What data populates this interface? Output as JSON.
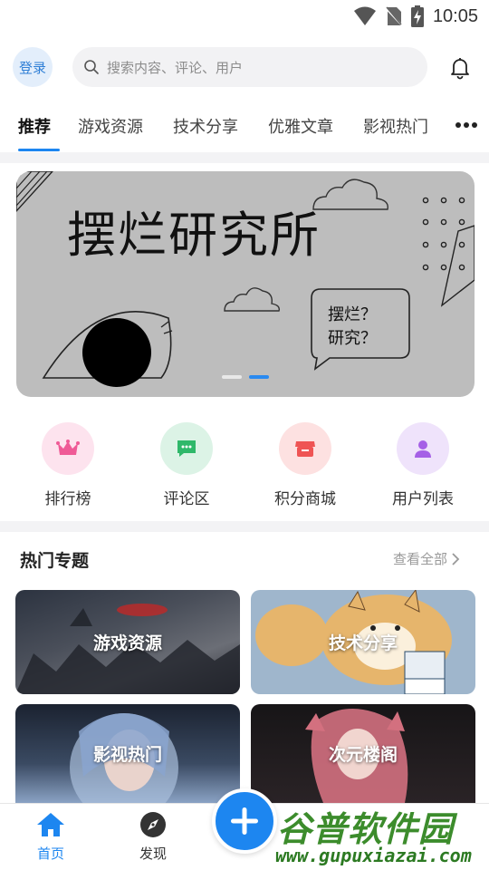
{
  "status_bar": {
    "time": "10:05"
  },
  "header": {
    "login_label": "登录",
    "search_placeholder": "搜索内容、评论、用户"
  },
  "tabs": [
    {
      "label": "推荐",
      "active": true
    },
    {
      "label": "游戏资源",
      "active": false
    },
    {
      "label": "技术分享",
      "active": false
    },
    {
      "label": "优雅文章",
      "active": false
    },
    {
      "label": "影视热门",
      "active": false
    }
  ],
  "banner": {
    "title": "摆烂研究所",
    "bubble_line1": "摆烂？",
    "bubble_line2": "研究？",
    "slide_count": 2,
    "active_slide": 2
  },
  "quick_entries": [
    {
      "label": "排行榜",
      "icon": "crown-icon",
      "bg": "#fde3ee",
      "color": "#ef5a96"
    },
    {
      "label": "评论区",
      "icon": "chat-icon",
      "bg": "#dcf3e6",
      "color": "#2fb86a"
    },
    {
      "label": "积分商城",
      "icon": "store-icon",
      "bg": "#fde1e1",
      "color": "#ef5454"
    },
    {
      "label": "用户列表",
      "icon": "user-icon",
      "bg": "#efe3fb",
      "color": "#a560e6"
    }
  ],
  "hot_topics": {
    "title": "热门专题",
    "view_all": "查看全部",
    "cards": [
      {
        "label": "游戏资源"
      },
      {
        "label": "技术分享"
      },
      {
        "label": "影视热门"
      },
      {
        "label": "次元楼阁"
      }
    ]
  },
  "bottom_nav": {
    "items": [
      {
        "label": "首页",
        "icon": "home-icon",
        "active": true
      },
      {
        "label": "发现",
        "icon": "compass-icon",
        "active": false
      }
    ],
    "fab_icon": "plus-icon"
  },
  "watermark": {
    "text": "谷普软件园",
    "url": "www.gupuxiazai.com"
  },
  "colors": {
    "accent": "#1d86f0",
    "watermark": "#3c8c2c"
  }
}
